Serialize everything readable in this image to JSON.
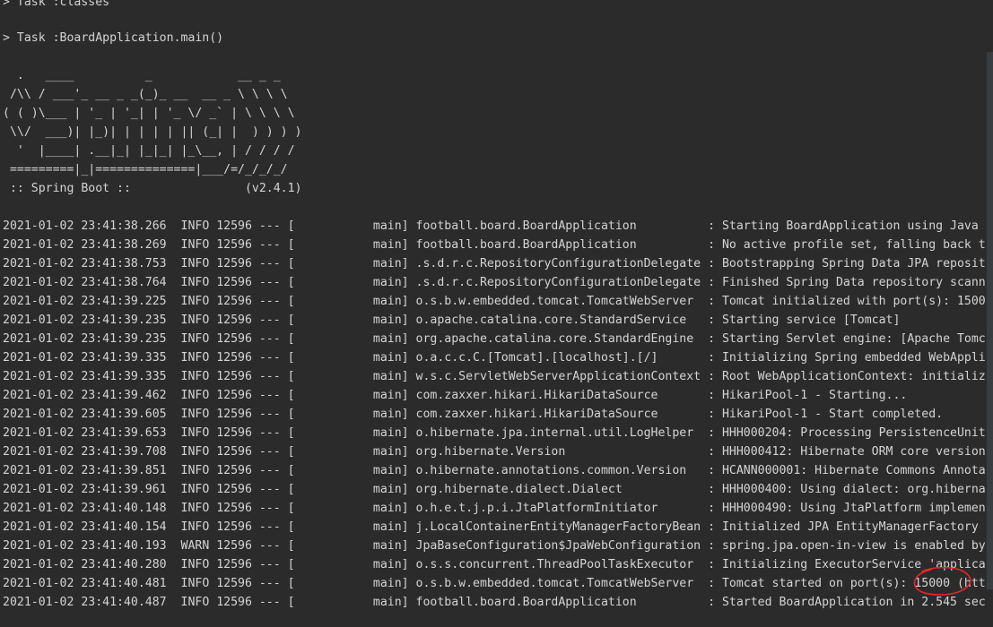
{
  "console": {
    "task_lines": [
      "> Task :classes",
      "> Task :BoardApplication.main()"
    ],
    "banner": [
      "  .   ____          _            __ _ _",
      " /\\\\ / ___'_ __ _ _(_)_ __  __ _ \\ \\ \\ \\",
      "( ( )\\___ | '_ | '_| | '_ \\/ _` | \\ \\ \\ \\",
      " \\\\/  ___)| |_)| | | | | || (_| |  ) ) ) )",
      "  '  |____| .__|_| |_|_| |_\\__, | / / / /",
      " =========|_|==============|___/=/_/_/_/",
      " :: Spring Boot ::                (v2.4.1)"
    ],
    "log": [
      {
        "timestamp": "2021-01-02 23:41:38.266",
        "level": "INFO",
        "pid": "12596",
        "sep": "---",
        "thread": "[           main]",
        "logger": "football.board.BoardApplication         ",
        "message": ": Starting BoardApplication using Java"
      },
      {
        "timestamp": "2021-01-02 23:41:38.269",
        "level": "INFO",
        "pid": "12596",
        "sep": "---",
        "thread": "[           main]",
        "logger": "football.board.BoardApplication         ",
        "message": ": No active profile set, falling back t"
      },
      {
        "timestamp": "2021-01-02 23:41:38.753",
        "level": "INFO",
        "pid": "12596",
        "sep": "---",
        "thread": "[           main]",
        "logger": ".s.d.r.c.RepositoryConfigurationDelegate",
        "message": ": Bootstrapping Spring Data JPA reposit"
      },
      {
        "timestamp": "2021-01-02 23:41:38.764",
        "level": "INFO",
        "pid": "12596",
        "sep": "---",
        "thread": "[           main]",
        "logger": ".s.d.r.c.RepositoryConfigurationDelegate",
        "message": ": Finished Spring Data repository scann"
      },
      {
        "timestamp": "2021-01-02 23:41:39.225",
        "level": "INFO",
        "pid": "12596",
        "sep": "---",
        "thread": "[           main]",
        "logger": "o.s.b.w.embedded.tomcat.TomcatWebServer ",
        "message": ": Tomcat initialized with port(s): 1500"
      },
      {
        "timestamp": "2021-01-02 23:41:39.235",
        "level": "INFO",
        "pid": "12596",
        "sep": "---",
        "thread": "[           main]",
        "logger": "o.apache.catalina.core.StandardService  ",
        "message": ": Starting service [Tomcat]"
      },
      {
        "timestamp": "2021-01-02 23:41:39.235",
        "level": "INFO",
        "pid": "12596",
        "sep": "---",
        "thread": "[           main]",
        "logger": "org.apache.catalina.core.StandardEngine ",
        "message": ": Starting Servlet engine: [Apache Tomc"
      },
      {
        "timestamp": "2021-01-02 23:41:39.335",
        "level": "INFO",
        "pid": "12596",
        "sep": "---",
        "thread": "[           main]",
        "logger": "o.a.c.c.C.[Tomcat].[localhost].[/]      ",
        "message": ": Initializing Spring embedded WebAppli"
      },
      {
        "timestamp": "2021-01-02 23:41:39.335",
        "level": "INFO",
        "pid": "12596",
        "sep": "---",
        "thread": "[           main]",
        "logger": "w.s.c.ServletWebServerApplicationContext",
        "message": ": Root WebApplicationContext: initializ"
      },
      {
        "timestamp": "2021-01-02 23:41:39.462",
        "level": "INFO",
        "pid": "12596",
        "sep": "---",
        "thread": "[           main]",
        "logger": "com.zaxxer.hikari.HikariDataSource      ",
        "message": ": HikariPool-1 - Starting..."
      },
      {
        "timestamp": "2021-01-02 23:41:39.605",
        "level": "INFO",
        "pid": "12596",
        "sep": "---",
        "thread": "[           main]",
        "logger": "com.zaxxer.hikari.HikariDataSource      ",
        "message": ": HikariPool-1 - Start completed."
      },
      {
        "timestamp": "2021-01-02 23:41:39.653",
        "level": "INFO",
        "pid": "12596",
        "sep": "---",
        "thread": "[           main]",
        "logger": "o.hibernate.jpa.internal.util.LogHelper ",
        "message": ": HHH000204: Processing PersistenceUnit"
      },
      {
        "timestamp": "2021-01-02 23:41:39.708",
        "level": "INFO",
        "pid": "12596",
        "sep": "---",
        "thread": "[           main]",
        "logger": "org.hibernate.Version                   ",
        "message": ": HHH000412: Hibernate ORM core version"
      },
      {
        "timestamp": "2021-01-02 23:41:39.851",
        "level": "INFO",
        "pid": "12596",
        "sep": "---",
        "thread": "[           main]",
        "logger": "o.hibernate.annotations.common.Version  ",
        "message": ": HCANN000001: Hibernate Commons Annota"
      },
      {
        "timestamp": "2021-01-02 23:41:39.961",
        "level": "INFO",
        "pid": "12596",
        "sep": "---",
        "thread": "[           main]",
        "logger": "org.hibernate.dialect.Dialect           ",
        "message": ": HHH000400: Using dialect: org.hiberna"
      },
      {
        "timestamp": "2021-01-02 23:41:40.148",
        "level": "INFO",
        "pid": "12596",
        "sep": "---",
        "thread": "[           main]",
        "logger": "o.h.e.t.j.p.i.JtaPlatformInitiator      ",
        "message": ": HHH000490: Using JtaPlatform implemen"
      },
      {
        "timestamp": "2021-01-02 23:41:40.154",
        "level": "INFO",
        "pid": "12596",
        "sep": "---",
        "thread": "[           main]",
        "logger": "j.LocalContainerEntityManagerFactoryBean",
        "message": ": Initialized JPA EntityManagerFactory"
      },
      {
        "timestamp": "2021-01-02 23:41:40.193",
        "level": "WARN",
        "pid": "12596",
        "sep": "---",
        "thread": "[           main]",
        "logger": "JpaBaseConfiguration$JpaWebConfiguration",
        "message": ": spring.jpa.open-in-view is enabled by"
      },
      {
        "timestamp": "2021-01-02 23:41:40.280",
        "level": "INFO",
        "pid": "12596",
        "sep": "---",
        "thread": "[           main]",
        "logger": "o.s.s.concurrent.ThreadPoolTaskExecutor ",
        "message": ": Initializing ExecutorService 'applica"
      },
      {
        "timestamp": "2021-01-02 23:41:40.481",
        "level": "INFO",
        "pid": "12596",
        "sep": "---",
        "thread": "[           main]",
        "logger": "o.s.b.w.embedded.tomcat.TomcatWebServer ",
        "message": ": Tomcat started on port(s): 15000 (htt"
      },
      {
        "timestamp": "2021-01-02 23:41:40.487",
        "level": "INFO",
        "pid": "12596",
        "sep": "---",
        "thread": "[           main]",
        "logger": "football.board.BoardApplication         ",
        "message": ": Started BoardApplication in 2.545 sec"
      }
    ]
  },
  "colors": {
    "background": "#2b2b2b",
    "text": "#d4d4d4",
    "annotation": "#e8262b"
  }
}
